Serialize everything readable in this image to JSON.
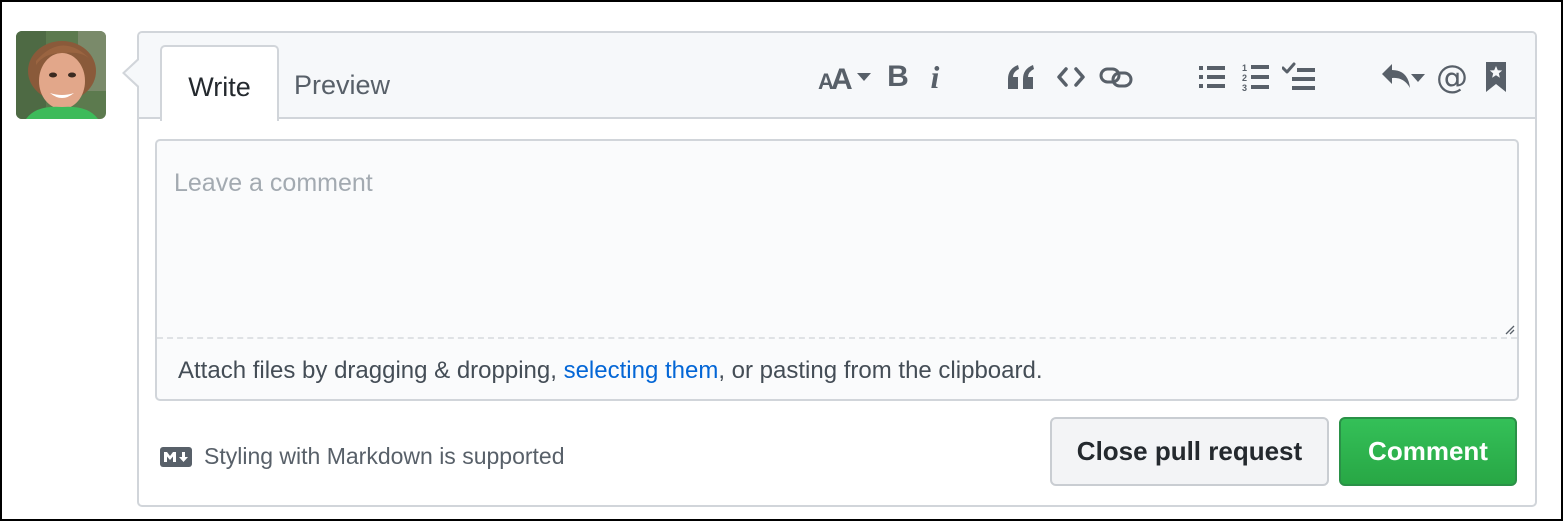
{
  "tabs": [
    {
      "label": "Write",
      "active": true
    },
    {
      "label": "Preview",
      "active": false
    }
  ],
  "toolbar": {
    "icons": [
      "text-size-icon",
      "bold-icon",
      "italic-icon",
      "quote-icon",
      "code-icon",
      "link-icon",
      "unordered-list-icon",
      "ordered-list-icon",
      "task-list-icon",
      "reply-icon",
      "mention-icon",
      "bookmark-icon"
    ],
    "bold_glyph": "B",
    "italic_glyph": "i",
    "mention_glyph": "@"
  },
  "comment": {
    "value": "",
    "placeholder": "Leave a comment"
  },
  "attach": {
    "before": "Attach files by dragging & dropping, ",
    "link": "selecting them",
    "after": ", or pasting from the clipboard."
  },
  "markdown_note": "Styling with Markdown is supported",
  "buttons": {
    "close": "Close pull request",
    "comment": "Comment"
  },
  "colors": {
    "accent_green": "#2ea44f",
    "link_blue": "#0366d6"
  }
}
